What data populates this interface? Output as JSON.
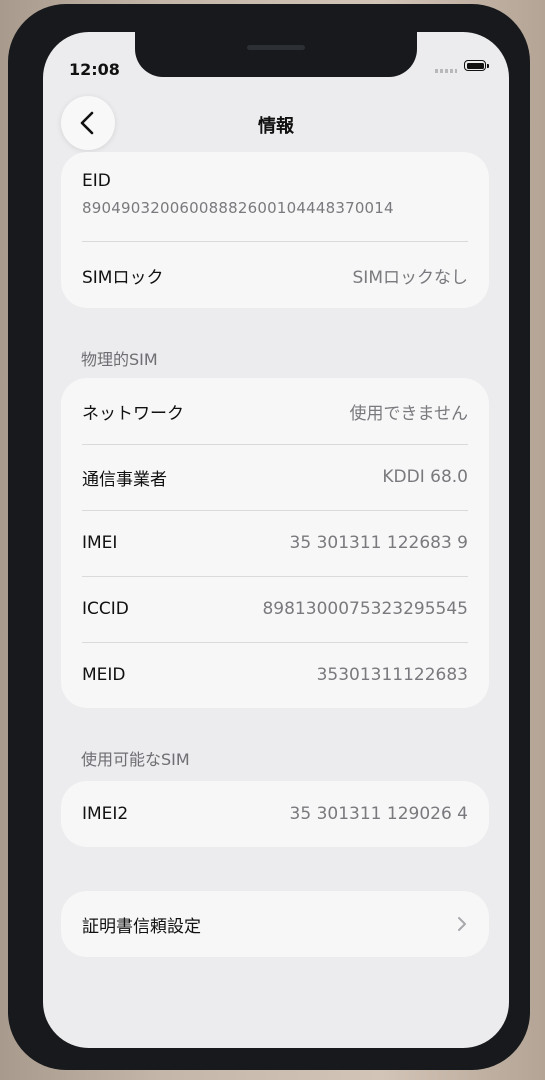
{
  "status_bar": {
    "time": "12:08"
  },
  "nav": {
    "title": "情報",
    "back_icon": "chevron-left-icon"
  },
  "top_card": {
    "eid_label": "EID",
    "eid_value": "89049032006008882600104448370014",
    "sim_lock_label": "SIMロック",
    "sim_lock_value": "SIMロックなし"
  },
  "physical_sim": {
    "header": "物理的SIM",
    "rows": [
      {
        "label": "ネットワーク",
        "value": "使用できません"
      },
      {
        "label": "通信事業者",
        "value": "KDDI 68.0"
      },
      {
        "label": "IMEI",
        "value": "35 301311 122683 9"
      },
      {
        "label": "ICCID",
        "value": "8981300075323295545"
      },
      {
        "label": "MEID",
        "value": "35301311122683"
      }
    ]
  },
  "available_sim": {
    "header": "使用可能なSIM",
    "rows": [
      {
        "label": "IMEI2",
        "value": "35 301311 129026 4"
      }
    ]
  },
  "cert_trust": {
    "label": "証明書信頼設定",
    "icon": "chevron-right-icon"
  },
  "colors": {
    "background": "#ececee",
    "card": "#f7f7f8",
    "secondary_text": "#7a7a7e",
    "section_header": "#6e6e73"
  }
}
